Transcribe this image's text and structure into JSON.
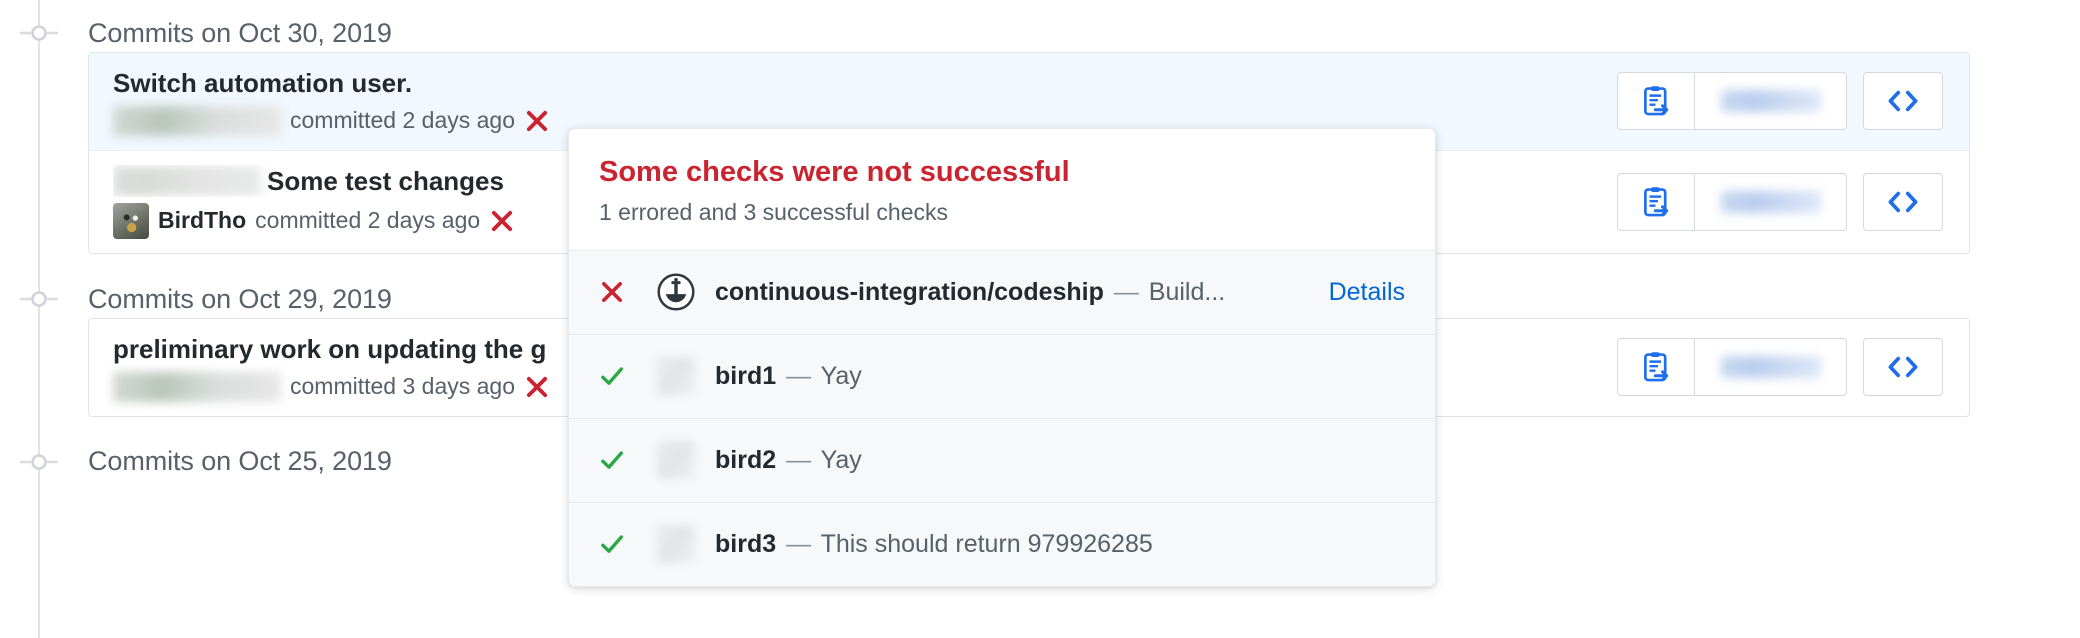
{
  "colors": {
    "error_red": "#cb2431",
    "success_green": "#28a745",
    "link_blue": "#0366d6",
    "muted_text": "#586069",
    "row_bg": "#f6f8fa",
    "highlight_bg": "#f1f8ff",
    "border": "#e1e4e8"
  },
  "timeline": {
    "groups": [
      {
        "date_label": "Commits on Oct 30, 2019",
        "marker_icon": "commit-node-icon",
        "commits": [
          {
            "title": "Switch automation user.",
            "title_redacted": false,
            "author": "",
            "author_redacted": true,
            "meta": "committed 2 days ago",
            "status_icon": "x-icon",
            "status": "error",
            "highlight": true,
            "avatar": "redacted",
            "actions": {
              "copy_icon": "copy-sha-icon",
              "sha": "",
              "sha_redacted": true,
              "browse_icon": "code-brackets-icon"
            }
          },
          {
            "title": "Some test changes",
            "title_redacted": true,
            "author": "BirdTho",
            "author_redacted": false,
            "meta": "committed 2 days ago",
            "status_icon": "x-icon",
            "status": "error",
            "highlight": false,
            "avatar": "bird-photo",
            "actions": {
              "copy_icon": "copy-sha-icon",
              "sha": "",
              "sha_redacted": true,
              "browse_icon": "code-brackets-icon"
            }
          }
        ]
      },
      {
        "date_label": "Commits on Oct 29, 2019",
        "marker_icon": "commit-node-icon",
        "commits": [
          {
            "title": "preliminary work on updating the g",
            "title_redacted": false,
            "author": "",
            "author_redacted": true,
            "meta": "committed 3 days ago",
            "status_icon": "x-icon",
            "status": "error",
            "highlight": false,
            "avatar": "redacted",
            "actions": {
              "copy_icon": "copy-sha-icon",
              "sha": "",
              "sha_redacted": true,
              "browse_icon": "code-brackets-icon"
            }
          }
        ]
      },
      {
        "date_label": "Commits on Oct 25, 2019",
        "marker_icon": "commit-node-icon",
        "commits": []
      }
    ]
  },
  "popover": {
    "title": "Some checks were not successful",
    "subtitle": "1 errored and 3 successful checks",
    "checks": [
      {
        "status": "error",
        "status_icon": "x-icon",
        "avatar_icon": "codeship-logo-icon",
        "avatar_type": "codeship",
        "context": "continuous-integration/codeship",
        "dash": "—",
        "description": "Build...",
        "details_label": "Details",
        "has_details": true
      },
      {
        "status": "success",
        "status_icon": "check-icon",
        "avatar_icon": "avatar-redacted",
        "avatar_type": "redacted",
        "context": "bird1",
        "dash": "—",
        "description": "Yay",
        "details_label": "",
        "has_details": false
      },
      {
        "status": "success",
        "status_icon": "check-icon",
        "avatar_icon": "avatar-redacted",
        "avatar_type": "redacted",
        "context": "bird2",
        "dash": "—",
        "description": "Yay",
        "details_label": "",
        "has_details": false
      },
      {
        "status": "success",
        "status_icon": "check-icon",
        "avatar_icon": "avatar-redacted",
        "avatar_type": "redacted",
        "context": "bird3",
        "dash": "—",
        "description": "This should return 979926285",
        "details_label": "",
        "has_details": false
      }
    ]
  }
}
